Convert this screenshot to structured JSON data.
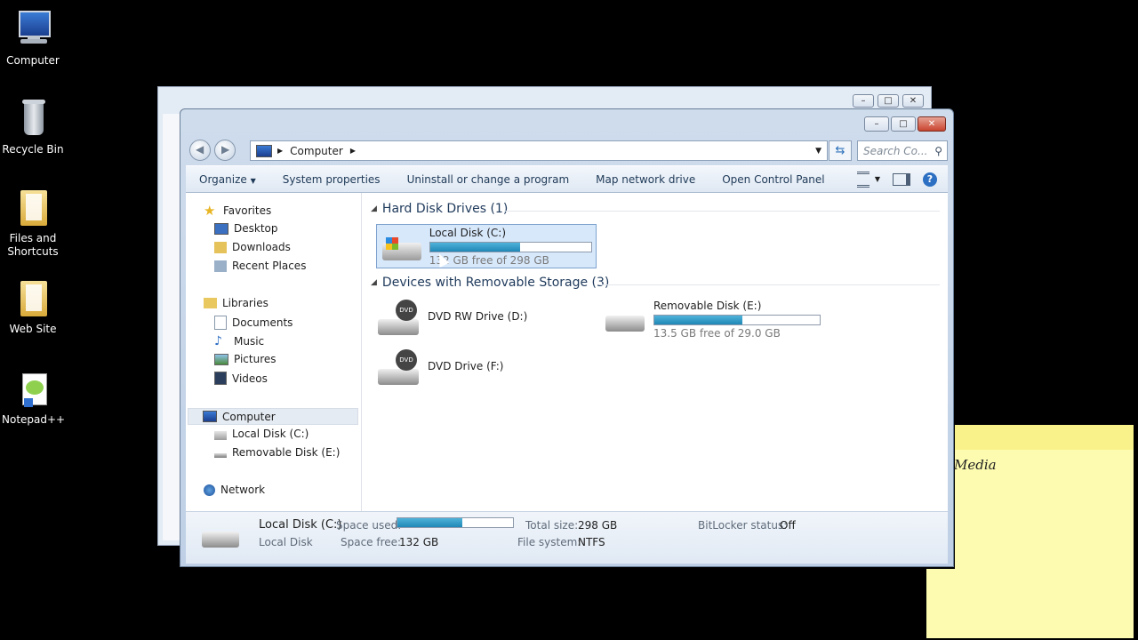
{
  "desktop": {
    "icons": [
      {
        "label": "Computer",
        "icon": "computer-icon"
      },
      {
        "label": "Recycle Bin",
        "icon": "recycle-bin-icon"
      },
      {
        "label": "Files and Shortcuts",
        "icon": "folder-icon"
      },
      {
        "label": "Web Site",
        "icon": "folder-icon"
      },
      {
        "label": "Notepad++",
        "icon": "notepad-plus-plus-icon"
      }
    ],
    "sticky_note": {
      "text": "Media"
    }
  },
  "window": {
    "caption_buttons": {
      "minimize": "–",
      "maximize": "□",
      "close": "✕"
    },
    "address": {
      "location": "Computer"
    },
    "search": {
      "placeholder": "Search Co..."
    },
    "toolbar": {
      "organize": "Organize",
      "system_properties": "System properties",
      "uninstall": "Uninstall or change a program",
      "map_drive": "Map network drive",
      "control_panel": "Open Control Panel"
    },
    "nav_pane": {
      "favorites": "Favorites",
      "favorites_items": [
        "Desktop",
        "Downloads",
        "Recent Places"
      ],
      "libraries": "Libraries",
      "libraries_items": [
        "Documents",
        "Music",
        "Pictures",
        "Videos"
      ],
      "computer": "Computer",
      "computer_items": [
        "Local Disk (C:)",
        "Removable Disk (E:)"
      ],
      "network": "Network"
    },
    "groups": {
      "hard_disks": "Hard Disk Drives (1)",
      "removable": "Devices with Removable Storage (3)"
    },
    "drives": {
      "c": {
        "name": "Local Disk (C:)",
        "free_text": "132 GB free of 298 GB",
        "used_fraction": 0.56
      },
      "d": {
        "name": "DVD RW Drive (D:)"
      },
      "e": {
        "name": "Removable Disk (E:)",
        "free_text": "13.5 GB free of 29.0 GB",
        "used_fraction": 0.53
      },
      "f": {
        "name": "DVD Drive (F:)"
      }
    },
    "details": {
      "name": "Local Disk (C:)",
      "type": "Local Disk",
      "space_used_label": "Space used:",
      "space_used_fraction": 0.56,
      "space_free_label": "Space free:",
      "space_free": "132 GB",
      "total_size_label": "Total size:",
      "total_size": "298 GB",
      "file_system_label": "File system:",
      "file_system": "NTFS",
      "bitlocker_label": "BitLocker status:",
      "bitlocker": "Off"
    }
  }
}
